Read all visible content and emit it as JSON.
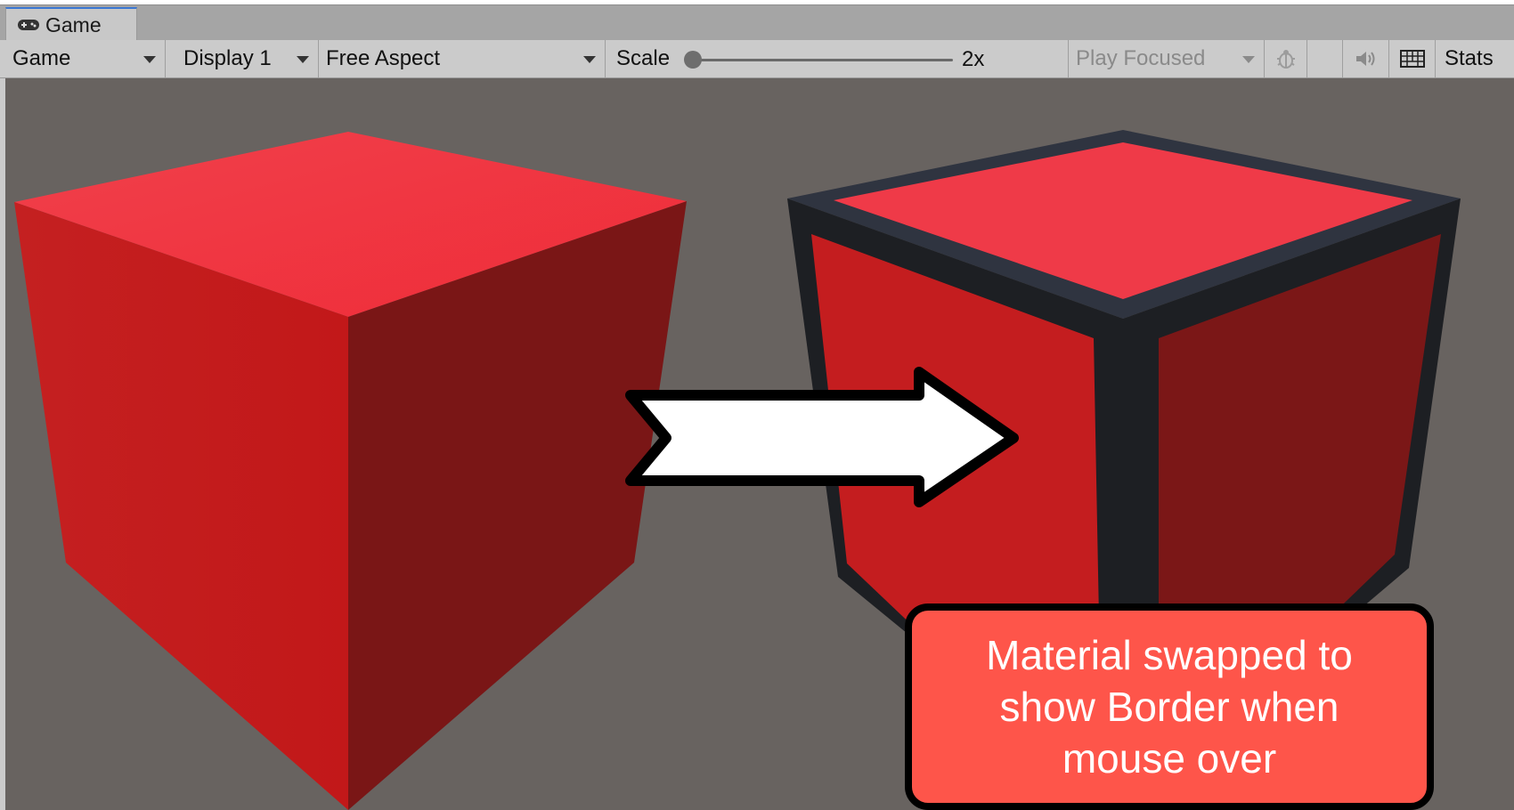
{
  "window": {
    "tab_label": "Game",
    "tab_icon": "gamepad-icon"
  },
  "toolbar": {
    "view_mode": "Game",
    "display": "Display 1",
    "aspect": "Free Aspect",
    "scale_label": "Scale",
    "scale_value": "2x",
    "play_mode": "Play Focused",
    "stats_label": "Stats",
    "icons": [
      "bug-icon",
      "speaker-icon",
      "keyboard-icon"
    ]
  },
  "scene": {
    "background": "#686360",
    "cube_color": "#e42127",
    "border_color": "#1e2024"
  },
  "callout": {
    "text": "Material swapped to show Border when mouse over",
    "fill": "#fe554a"
  }
}
